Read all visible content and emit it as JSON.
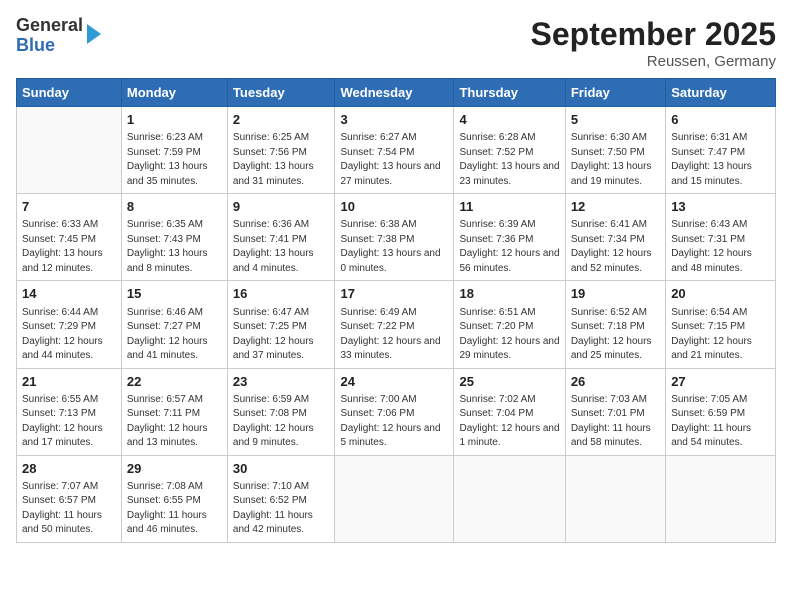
{
  "logo": {
    "general": "General",
    "blue": "Blue"
  },
  "title": "September 2025",
  "subtitle": "Reussen, Germany",
  "days_of_week": [
    "Sunday",
    "Monday",
    "Tuesday",
    "Wednesday",
    "Thursday",
    "Friday",
    "Saturday"
  ],
  "weeks": [
    [
      {
        "day": "",
        "info": ""
      },
      {
        "day": "1",
        "info": "Sunrise: 6:23 AM\nSunset: 7:59 PM\nDaylight: 13 hours and 35 minutes."
      },
      {
        "day": "2",
        "info": "Sunrise: 6:25 AM\nSunset: 7:56 PM\nDaylight: 13 hours and 31 minutes."
      },
      {
        "day": "3",
        "info": "Sunrise: 6:27 AM\nSunset: 7:54 PM\nDaylight: 13 hours and 27 minutes."
      },
      {
        "day": "4",
        "info": "Sunrise: 6:28 AM\nSunset: 7:52 PM\nDaylight: 13 hours and 23 minutes."
      },
      {
        "day": "5",
        "info": "Sunrise: 6:30 AM\nSunset: 7:50 PM\nDaylight: 13 hours and 19 minutes."
      },
      {
        "day": "6",
        "info": "Sunrise: 6:31 AM\nSunset: 7:47 PM\nDaylight: 13 hours and 15 minutes."
      }
    ],
    [
      {
        "day": "7",
        "info": "Sunrise: 6:33 AM\nSunset: 7:45 PM\nDaylight: 13 hours and 12 minutes."
      },
      {
        "day": "8",
        "info": "Sunrise: 6:35 AM\nSunset: 7:43 PM\nDaylight: 13 hours and 8 minutes."
      },
      {
        "day": "9",
        "info": "Sunrise: 6:36 AM\nSunset: 7:41 PM\nDaylight: 13 hours and 4 minutes."
      },
      {
        "day": "10",
        "info": "Sunrise: 6:38 AM\nSunset: 7:38 PM\nDaylight: 13 hours and 0 minutes."
      },
      {
        "day": "11",
        "info": "Sunrise: 6:39 AM\nSunset: 7:36 PM\nDaylight: 12 hours and 56 minutes."
      },
      {
        "day": "12",
        "info": "Sunrise: 6:41 AM\nSunset: 7:34 PM\nDaylight: 12 hours and 52 minutes."
      },
      {
        "day": "13",
        "info": "Sunrise: 6:43 AM\nSunset: 7:31 PM\nDaylight: 12 hours and 48 minutes."
      }
    ],
    [
      {
        "day": "14",
        "info": "Sunrise: 6:44 AM\nSunset: 7:29 PM\nDaylight: 12 hours and 44 minutes."
      },
      {
        "day": "15",
        "info": "Sunrise: 6:46 AM\nSunset: 7:27 PM\nDaylight: 12 hours and 41 minutes."
      },
      {
        "day": "16",
        "info": "Sunrise: 6:47 AM\nSunset: 7:25 PM\nDaylight: 12 hours and 37 minutes."
      },
      {
        "day": "17",
        "info": "Sunrise: 6:49 AM\nSunset: 7:22 PM\nDaylight: 12 hours and 33 minutes."
      },
      {
        "day": "18",
        "info": "Sunrise: 6:51 AM\nSunset: 7:20 PM\nDaylight: 12 hours and 29 minutes."
      },
      {
        "day": "19",
        "info": "Sunrise: 6:52 AM\nSunset: 7:18 PM\nDaylight: 12 hours and 25 minutes."
      },
      {
        "day": "20",
        "info": "Sunrise: 6:54 AM\nSunset: 7:15 PM\nDaylight: 12 hours and 21 minutes."
      }
    ],
    [
      {
        "day": "21",
        "info": "Sunrise: 6:55 AM\nSunset: 7:13 PM\nDaylight: 12 hours and 17 minutes."
      },
      {
        "day": "22",
        "info": "Sunrise: 6:57 AM\nSunset: 7:11 PM\nDaylight: 12 hours and 13 minutes."
      },
      {
        "day": "23",
        "info": "Sunrise: 6:59 AM\nSunset: 7:08 PM\nDaylight: 12 hours and 9 minutes."
      },
      {
        "day": "24",
        "info": "Sunrise: 7:00 AM\nSunset: 7:06 PM\nDaylight: 12 hours and 5 minutes."
      },
      {
        "day": "25",
        "info": "Sunrise: 7:02 AM\nSunset: 7:04 PM\nDaylight: 12 hours and 1 minute."
      },
      {
        "day": "26",
        "info": "Sunrise: 7:03 AM\nSunset: 7:01 PM\nDaylight: 11 hours and 58 minutes."
      },
      {
        "day": "27",
        "info": "Sunrise: 7:05 AM\nSunset: 6:59 PM\nDaylight: 11 hours and 54 minutes."
      }
    ],
    [
      {
        "day": "28",
        "info": "Sunrise: 7:07 AM\nSunset: 6:57 PM\nDaylight: 11 hours and 50 minutes."
      },
      {
        "day": "29",
        "info": "Sunrise: 7:08 AM\nSunset: 6:55 PM\nDaylight: 11 hours and 46 minutes."
      },
      {
        "day": "30",
        "info": "Sunrise: 7:10 AM\nSunset: 6:52 PM\nDaylight: 11 hours and 42 minutes."
      },
      {
        "day": "",
        "info": ""
      },
      {
        "day": "",
        "info": ""
      },
      {
        "day": "",
        "info": ""
      },
      {
        "day": "",
        "info": ""
      }
    ]
  ]
}
